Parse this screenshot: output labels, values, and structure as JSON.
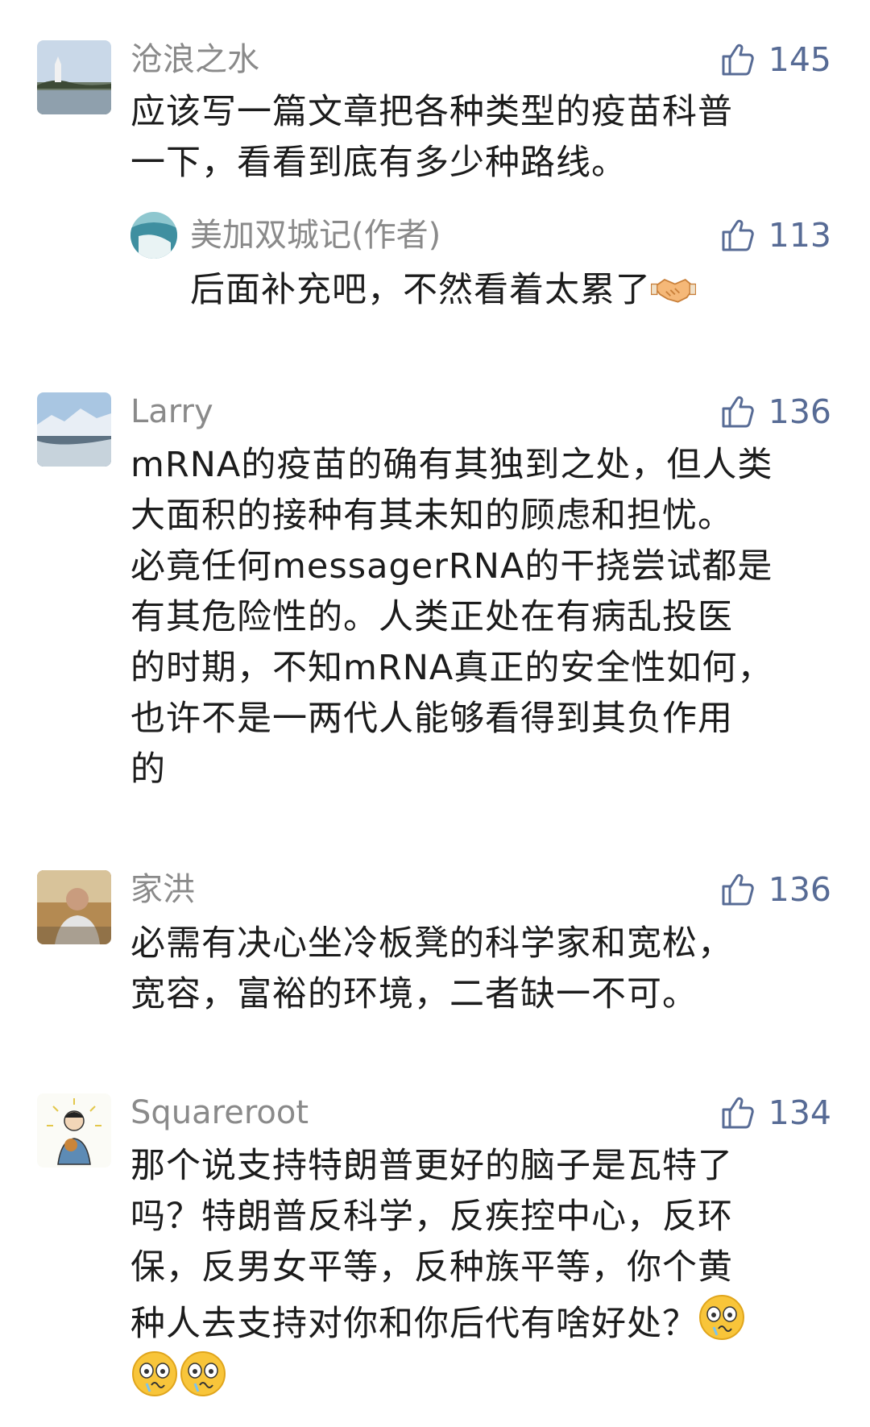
{
  "comments": [
    {
      "nickname": "沧浪之水",
      "likes": "145",
      "lines": [
        "应该写一篇文章把各种类型的疫苗科普",
        "一下，看看到底有多少种路线。"
      ],
      "reply": {
        "nickname": "美加双城记(作者)",
        "likes": "113",
        "text": "后面补充吧，不然看着太累了",
        "emoji": "handshake-emoji"
      }
    },
    {
      "nickname": "Larry",
      "likes": "136",
      "lines": [
        "mRNA的疫苗的确有其独到之处，但人类",
        "大面积的接种有其未知的顾虑和担忧。",
        "必竟任何messagerRNA的干挠尝试都是",
        "有其危险性的。人类正处在有病乱投医",
        "的时期，不知mRNA真正的安全性如何，",
        "也许不是一两代人能够看得到其负作用",
        "的"
      ]
    },
    {
      "nickname": "家洪",
      "likes": "136",
      "lines": [
        "必需有决心坐冷板凳的科学家和宽松，",
        "宽容，富裕的环境，二者缺一不可。"
      ]
    },
    {
      "nickname": "Squareroot",
      "likes": "134",
      "lines": [
        "那个说支持特朗普更好的脑子是瓦特了",
        "吗？特朗普反科学，反疾控中心，反环",
        "保，反男女平等，反种族平等，你个黄",
        "种人去支持对你和你后代有啥好处？"
      ],
      "emojis": [
        "dizzy-face-emoji",
        "dizzy-face-emoji",
        "dizzy-face-emoji"
      ]
    }
  ],
  "colors": {
    "like_blue": "#576b95",
    "nickname_gray": "#8a8a8a",
    "text": "#1c1c1c"
  }
}
